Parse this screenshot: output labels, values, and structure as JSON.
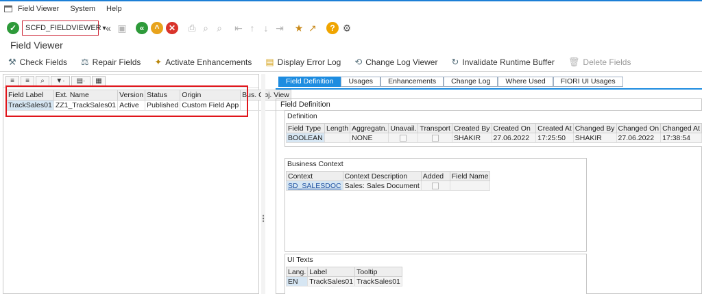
{
  "menubar": {
    "items": [
      "Field Viewer",
      "System",
      "Help"
    ]
  },
  "toolbar": {
    "command_value": "SCFD_FIELDVIEWER"
  },
  "page": {
    "title": "Field Viewer"
  },
  "app_toolbar": {
    "buttons": [
      {
        "label": "Check Fields",
        "icon": "check-fields-icon"
      },
      {
        "label": "Repair Fields",
        "icon": "repair-icon"
      },
      {
        "label": "Activate Enhancements",
        "icon": "wand-icon"
      },
      {
        "label": "Display Error Log",
        "icon": "log-icon"
      },
      {
        "label": "Change Log Viewer",
        "icon": "change-log-icon"
      },
      {
        "label": "Invalidate Runtime Buffer",
        "icon": "refresh-icon"
      },
      {
        "label": "Delete Fields",
        "icon": "trash-icon"
      }
    ]
  },
  "left_table": {
    "headers": [
      "Field Label",
      "Ext. Name",
      "Version",
      "Status",
      "Origin",
      "Bus. Obj. View"
    ],
    "rows": [
      [
        "TrackSales01",
        "ZZ1_TrackSales01",
        "Active",
        "Published",
        "Custom Field App",
        ""
      ]
    ]
  },
  "tabs": [
    {
      "label": "Field Definition",
      "active": true
    },
    {
      "label": "Usages",
      "active": false
    },
    {
      "label": "Enhancements",
      "active": false
    },
    {
      "label": "Change Log",
      "active": false
    },
    {
      "label": "Where Used",
      "active": false
    },
    {
      "label": "FIORI UI Usages",
      "active": false
    }
  ],
  "field_definition": {
    "title": "Field Definition",
    "definition": {
      "title": "Definition",
      "headers": [
        "Field Type",
        "Length",
        "Aggregatn.",
        "Unavail.",
        "Transport",
        "Created By",
        "Created On",
        "Created At",
        "Changed By",
        "Changed On",
        "Changed At"
      ],
      "row": [
        "BOOLEAN",
        "",
        "NONE",
        "",
        "",
        "SHAKIR",
        "27.06.2022",
        "17:25:50",
        "SHAKIR",
        "27.06.2022",
        "17:38:54"
      ]
    },
    "business_context": {
      "title": "Business Context",
      "headers": [
        "Context",
        "Context Description",
        "Added",
        "Field Name"
      ],
      "row": [
        "SD_SALESDOC",
        "Sales: Sales Document",
        "",
        ""
      ]
    },
    "ui_texts": {
      "title": "UI Texts",
      "headers": [
        "Lang.",
        "Label",
        "Tooltip"
      ],
      "row": [
        "EN",
        "TrackSales01",
        "TrackSales01"
      ]
    }
  },
  "colors": {
    "accent": "#1d8ce0",
    "highlight_box": "#e0151b",
    "key_cell": "#d6e6f3"
  }
}
